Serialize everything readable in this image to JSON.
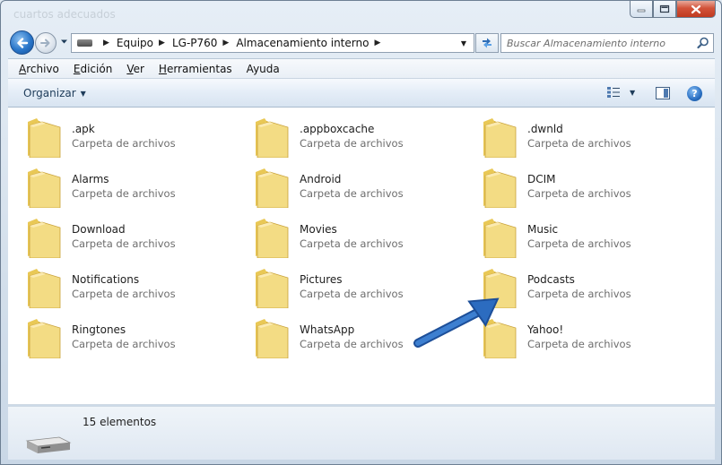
{
  "window": {
    "ghost_title": "cuartos adecuados",
    "colors": {
      "close": "#c0391f",
      "accent": "#2a76c9",
      "folder": "#f2d46b"
    }
  },
  "caption": {
    "minimize": "minimize-icon",
    "maximize": "maximize-icon",
    "close": "close-icon"
  },
  "address": {
    "breadcrumbs": [
      "Equipo",
      "LG-P760",
      "Almacenamiento interno"
    ]
  },
  "search": {
    "placeholder": "Buscar Almacenamiento interno"
  },
  "menu": {
    "items": [
      {
        "accel": "A",
        "rest": "rchivo"
      },
      {
        "accel": "E",
        "rest": "dición"
      },
      {
        "accel": "V",
        "rest": "er"
      },
      {
        "accel": "H",
        "rest": "erramientas"
      },
      {
        "accel": "",
        "rest": "Ayuda",
        "accel2": "u"
      }
    ]
  },
  "command": {
    "organize": "Organizar",
    "help": "?"
  },
  "files": [
    {
      "name": ".apk",
      "type": "Carpeta de archivos"
    },
    {
      "name": ".appboxcache",
      "type": "Carpeta de archivos"
    },
    {
      "name": ".dwnld",
      "type": "Carpeta de archivos"
    },
    {
      "name": "Alarms",
      "type": "Carpeta de archivos"
    },
    {
      "name": "Android",
      "type": "Carpeta de archivos"
    },
    {
      "name": "DCIM",
      "type": "Carpeta de archivos"
    },
    {
      "name": "Download",
      "type": "Carpeta de archivos"
    },
    {
      "name": "Movies",
      "type": "Carpeta de archivos"
    },
    {
      "name": "Music",
      "type": "Carpeta de archivos"
    },
    {
      "name": "Notifications",
      "type": "Carpeta de archivos"
    },
    {
      "name": "Pictures",
      "type": "Carpeta de archivos"
    },
    {
      "name": "Podcasts",
      "type": "Carpeta de archivos"
    },
    {
      "name": "Ringtones",
      "type": "Carpeta de archivos"
    },
    {
      "name": "WhatsApp",
      "type": "Carpeta de archivos"
    },
    {
      "name": "Yahoo!",
      "type": "Carpeta de archivos"
    }
  ],
  "details": {
    "count": "15 elementos"
  }
}
